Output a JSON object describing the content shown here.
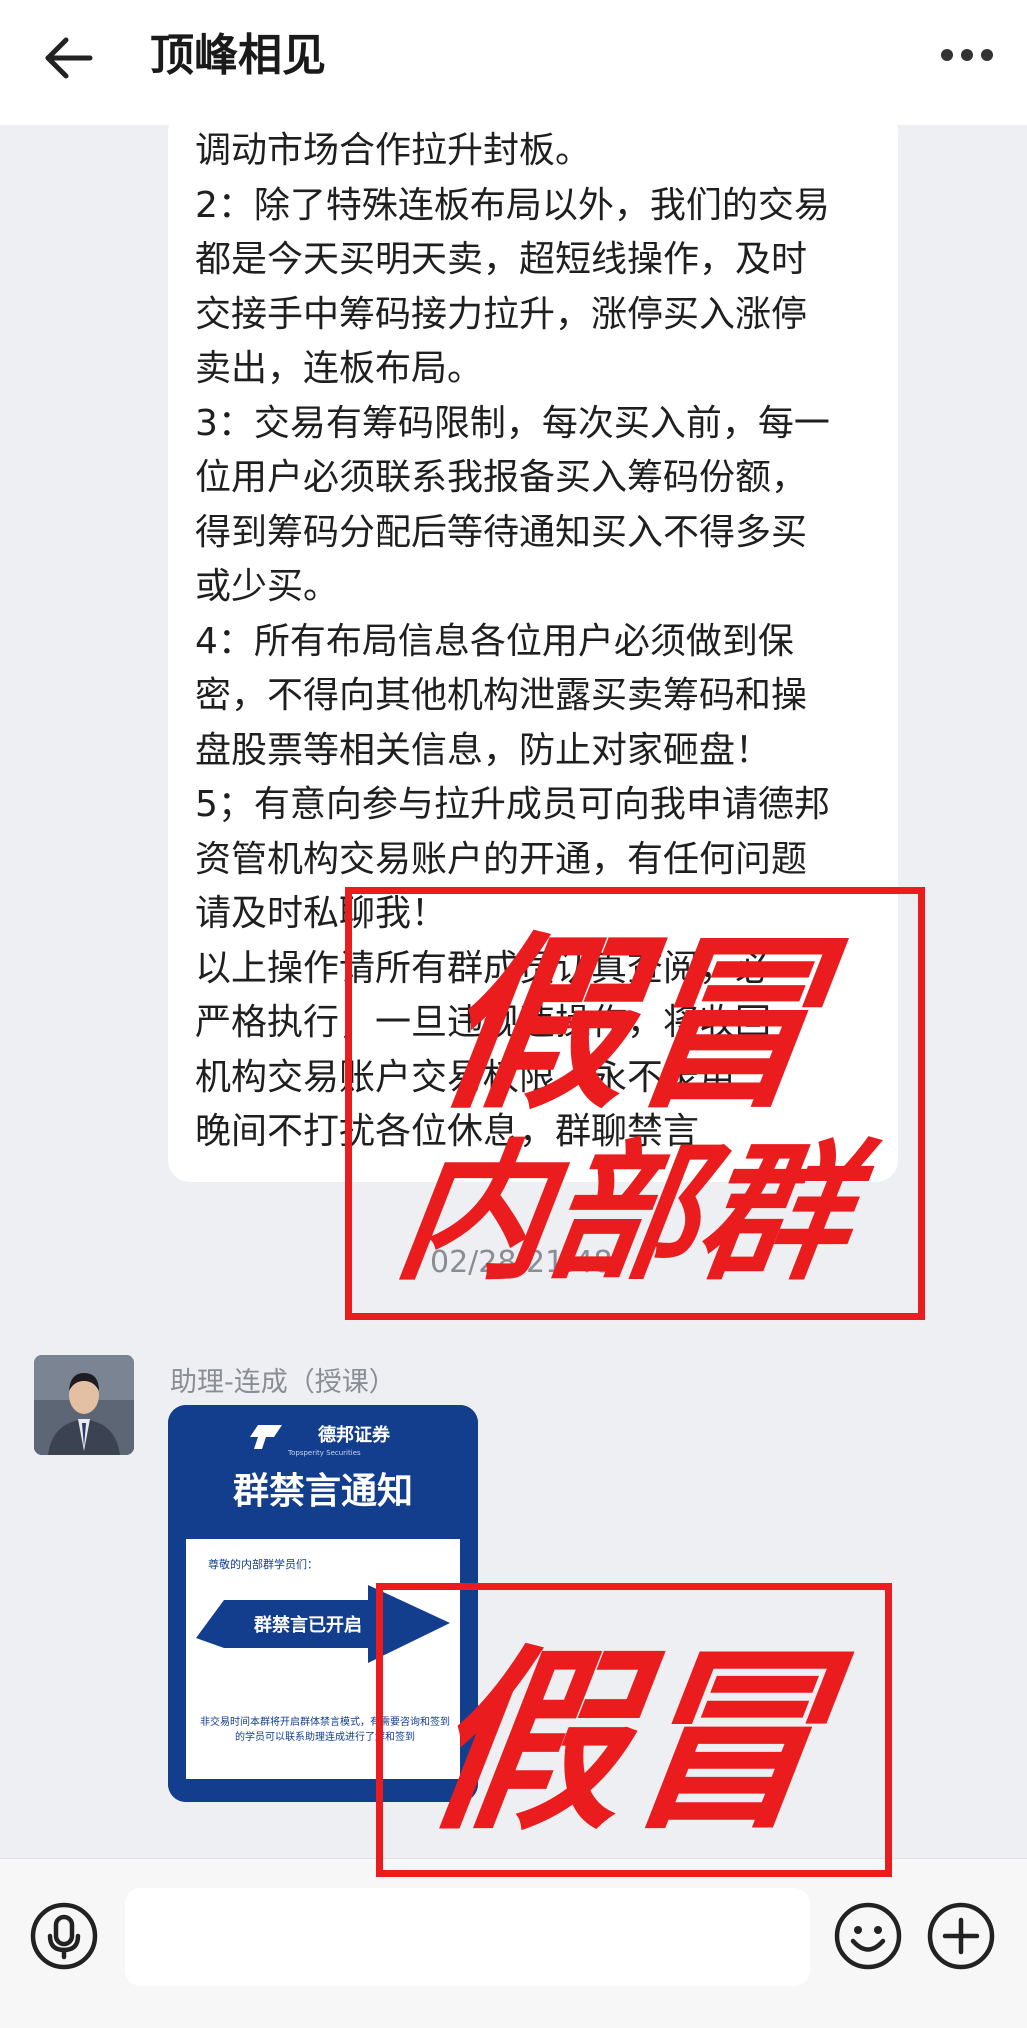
{
  "header": {
    "title": "顶峰相见",
    "back_icon": "arrow-left-icon",
    "more_icon": "more-dots-icon"
  },
  "message_top": {
    "lines": [
      "调动市场合作拉升封板。",
      "2：除了特殊连板布局以外，我们的交易",
      "都是今天买明天卖，超短线操作，及时",
      "交接手中筹码接力拉升，涨停买入涨停",
      "卖出，连板布局。",
      "3：交易有筹码限制，每次买入前，每一",
      "位用户必须联系我报备买入筹码份额，",
      "得到筹码分配后等待通知买入不得多买",
      "或少买。",
      "4：所有布局信息各位用户必须做到保",
      "密，不得向其他机构泄露买卖筹码和操",
      "盘股票等相关信息，防止对家砸盘！",
      "5；有意向参与拉升成员可向我申请德邦",
      "资管机构交易账户的开通，有任何问题",
      "请及时私聊我！",
      "以上操作请所有群成员认真查阅，必",
      "严格执行，一旦违规违操作，将收回",
      "机构交易账户交易权限，永不录用",
      "晚间不打扰各位休息，群聊禁言"
    ],
    "timestamp": "02/28 21:48"
  },
  "message_second": {
    "sender": "助理-连成（授课）",
    "card": {
      "brand": "德邦证券",
      "brand_en": "Topsperity Securities",
      "title": "群禁言通知",
      "greeting": "尊敬的内部群学员们：",
      "arrow_text": "群禁言已开启",
      "body": "非交易时间本群将开启群体禁言模式，有需要咨询和签到的学员可以联系助理连成进行了解和签到"
    }
  },
  "stamps": {
    "stamp1_line1": "假冒",
    "stamp1_line2": "内部群",
    "stamp2": "假冒",
    "color": "#ea1c1e"
  },
  "input_bar": {
    "placeholder": "",
    "voice_icon": "microphone-icon",
    "emoji_icon": "smiley-icon",
    "plus_icon": "plus-circle-icon"
  }
}
